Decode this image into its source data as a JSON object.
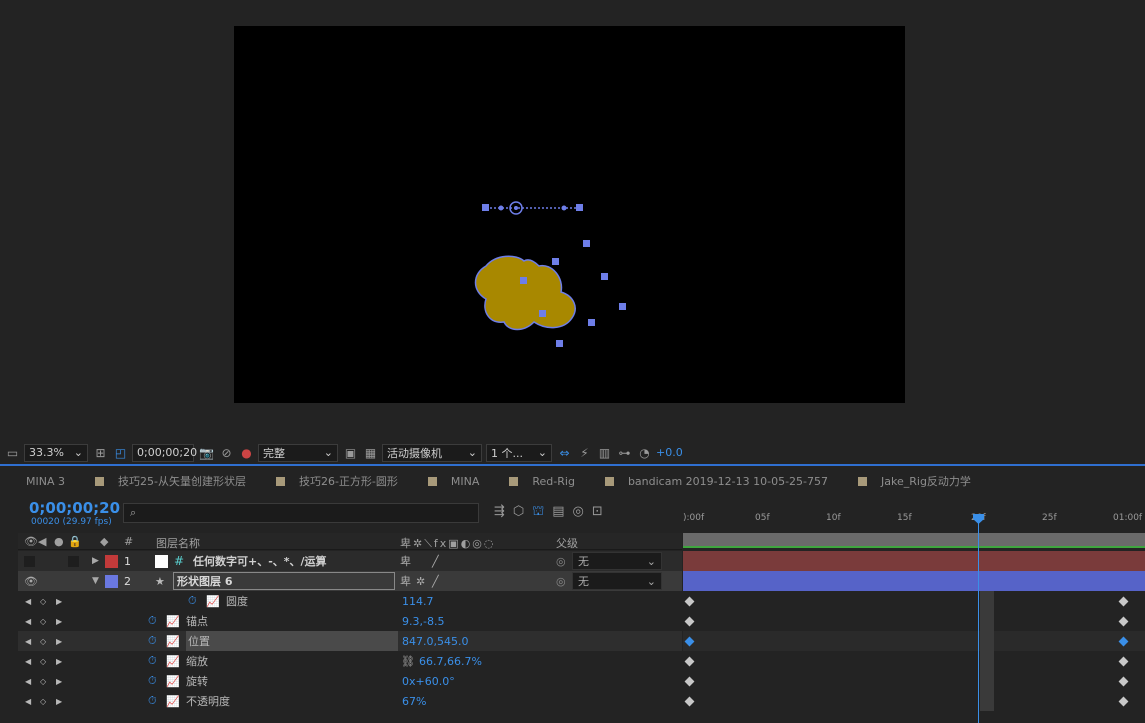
{
  "viewer": {
    "zoom": "33.3%",
    "timecode": "0;00;00;20",
    "resolution": "完整",
    "camera": "活动摄像机",
    "views": "1 个...",
    "exposure": "+0.0",
    "shape_color": "#a88800",
    "handle_color": "#6e7ee8"
  },
  "tabs": [
    {
      "label": "MINA 3",
      "swatch": ""
    },
    {
      "label": "技巧25-从矢量创建形状层",
      "swatch": "#a89a7a"
    },
    {
      "label": "技巧26-正方形-圆形",
      "swatch": "#a89a7a"
    },
    {
      "label": "MINA",
      "swatch": "#a89a7a"
    },
    {
      "label": "Red-Rig",
      "swatch": "#a89a7a"
    },
    {
      "label": "bandicam 2019-12-13 10-05-25-757",
      "swatch": "#a89a7a"
    },
    {
      "label": "Jake_Rig反动力学",
      "swatch": "#a89a7a"
    }
  ],
  "timeline": {
    "timecode": "0;00;00;20",
    "fps": "00020 (29.97 fps)",
    "ruler": [
      "):00f",
      "05f",
      "10f",
      "15f",
      "20f",
      "25f",
      "01:00f"
    ]
  },
  "headers": {
    "num": "#",
    "name": "图层名称",
    "parent": "父级"
  },
  "layers": [
    {
      "num": "1",
      "name": "任何数字可+、-、*、/运算",
      "label_color": "#c23a3a",
      "parent": "无",
      "bar_color": "#7a3b3b"
    },
    {
      "num": "2",
      "name": "形状图层 6",
      "label_color": "#6a78e0",
      "parent": "无",
      "bar_color": "#5663c8"
    }
  ],
  "properties": [
    {
      "name": "圆度",
      "value": "114.7"
    },
    {
      "name": "锚点",
      "value": "9.3,-8.5"
    },
    {
      "name": "位置",
      "value": "847.0,545.0"
    },
    {
      "name": "缩放",
      "value": "66.7,66.7%"
    },
    {
      "name": "旋转",
      "value": "0x+60.0°"
    },
    {
      "name": "不透明度",
      "value": "67%"
    }
  ]
}
